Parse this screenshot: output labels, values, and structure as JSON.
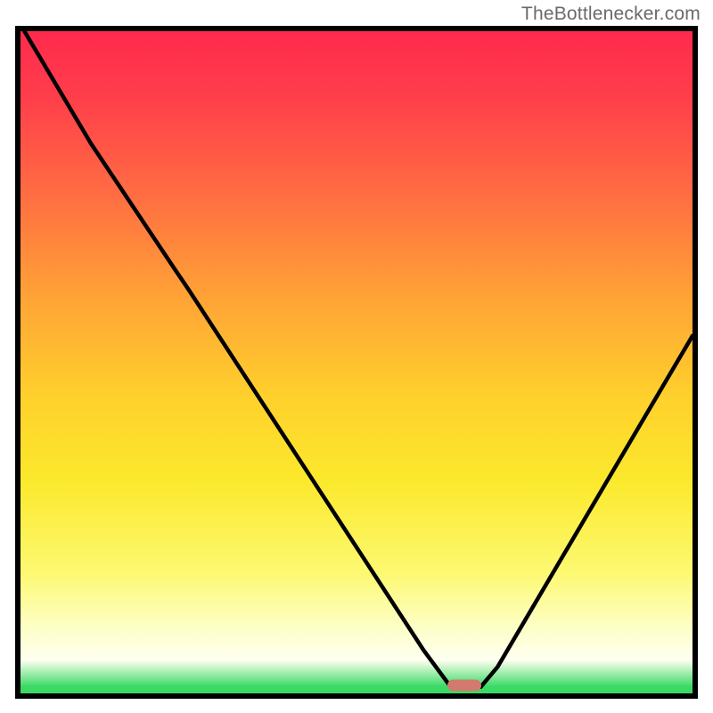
{
  "watermark": "TheBottlenecker.com",
  "chart_data": {
    "type": "line",
    "title": "",
    "xlabel": "",
    "ylabel": "",
    "xlim": [
      0,
      100
    ],
    "ylim": [
      0,
      100
    ],
    "series": [
      {
        "name": "curve",
        "x": [
          0.0,
          10.5,
          23.0,
          25.0,
          60.0,
          64.0,
          68.5,
          71.0,
          100.0
        ],
        "values": [
          101.0,
          83.0,
          64.0,
          61.0,
          6.5,
          1.0,
          1.0,
          4.0,
          54.0
        ]
      }
    ],
    "marker": {
      "x": 66.0,
      "y": 1.2
    },
    "gradient_stops": [
      {
        "pct": 0,
        "color": "#ff2a4d"
      },
      {
        "pct": 25,
        "color": "#ff6e42"
      },
      {
        "pct": 55,
        "color": "#ffd02c"
      },
      {
        "pct": 82,
        "color": "#fdf973"
      },
      {
        "pct": 95,
        "color": "#fefff0"
      },
      {
        "pct": 100,
        "color": "#3bd965"
      }
    ]
  }
}
